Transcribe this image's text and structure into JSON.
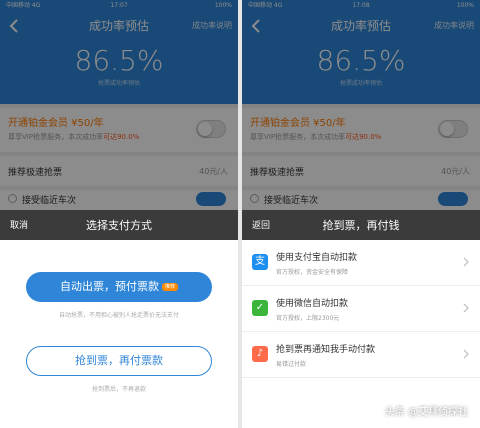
{
  "status": {
    "carrier": "中国移动 4G",
    "time_left": "17:07",
    "time_right": "17:08",
    "battery": "100%"
  },
  "nav": {
    "title": "成功率预估",
    "right": "成功率说明"
  },
  "hero": {
    "rate": "86.5%",
    "sub": "抢票成功率预估"
  },
  "member": {
    "title": "开通铂金会员 ¥50/年",
    "desc_prefix": "尊享VIP抢票服务，本次成功率",
    "desc_highlight": "可达90.0%"
  },
  "recommend": {
    "label": "推荐极速抢票",
    "value": "40元/人"
  },
  "partial": {
    "label": "接受临近车次"
  },
  "left_sheet": {
    "cancel": "取消",
    "title": "选择支付方式",
    "primary_button": "自动出票，预付票款",
    "badge": "推荐",
    "hint1": "自动抢票，不用担心被别人抢走票价无法支付",
    "secondary_button": "抢到票，再付票款",
    "hint2": "抢到票后，不再退款"
  },
  "right_sheet": {
    "back": "返回",
    "title": "抢到票，再付钱",
    "options": [
      {
        "icon": "alipay-icon",
        "glyph": "支",
        "color": "#1e8ff0",
        "title": "使用支付宝自动扣款",
        "desc": "官方授权，资金安全有保障"
      },
      {
        "icon": "wechat-icon",
        "glyph": "✓",
        "color": "#3bb53b",
        "title": "使用微信自动扣款",
        "desc": "官方授权，上限2300元"
      },
      {
        "icon": "bell-icon",
        "glyph": "♪",
        "color": "#ff6a4a",
        "title": "抢到票再通知我手动付款",
        "desc": "易错过付款"
      }
    ]
  },
  "watermark": "头条 @艾拜侦探社"
}
